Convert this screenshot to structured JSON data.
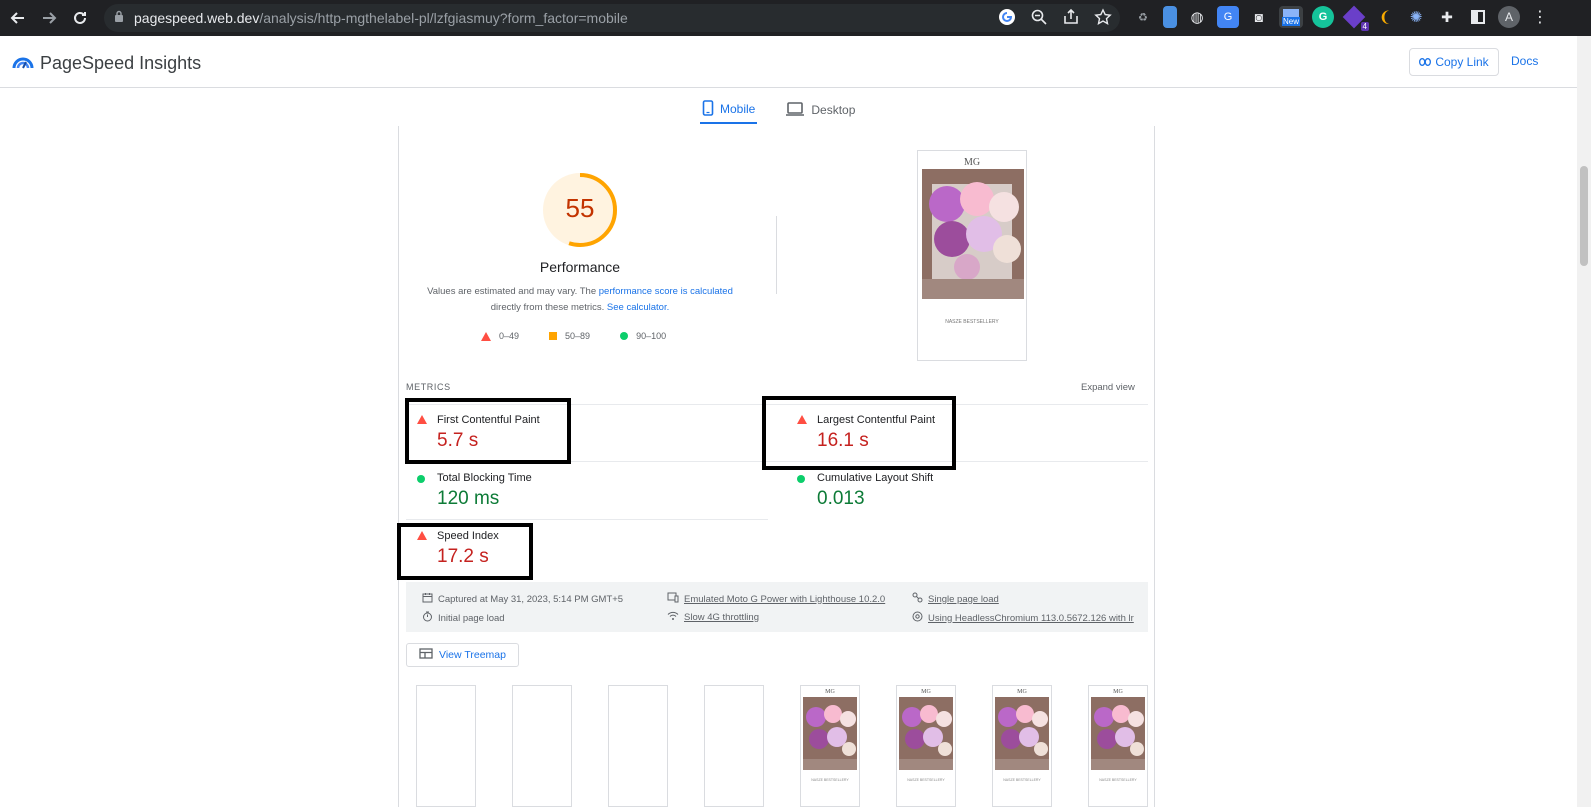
{
  "browser": {
    "url_host": "pagespeed.web.dev",
    "url_path": "/analysis/http-mgthelabel-pl/lzfgiasmuy?form_factor=mobile",
    "ext_badge_new": "New",
    "ext_badge_count": "4",
    "profile_initial": "A"
  },
  "header": {
    "title": "PageSpeed Insights",
    "copy_link": "Copy Link",
    "docs": "Docs"
  },
  "tabs": [
    {
      "label": "Mobile",
      "active": true
    },
    {
      "label": "Desktop",
      "active": false
    }
  ],
  "performance": {
    "score": "55",
    "label": "Performance",
    "note_prefix": "Values are estimated and may vary. The ",
    "note_link1": "performance score is calculated",
    "note_mid": " directly from these metrics. ",
    "note_link2": "See calculator.",
    "legend": [
      {
        "range": "0–49",
        "color": "#ff4e42"
      },
      {
        "range": "50–89",
        "color": "#ffa400"
      },
      {
        "range": "90–100",
        "color": "#0cce6b"
      }
    ]
  },
  "screenshot": {
    "logo": "MG",
    "caption": "NASZE BESTSELLERY"
  },
  "metrics": {
    "heading": "METRICS",
    "expand": "Expand view",
    "fcp": {
      "label": "First Contentful Paint",
      "value": "5.7 s"
    },
    "lcp": {
      "label": "Largest Contentful Paint",
      "value": "16.1 s"
    },
    "tbt": {
      "label": "Total Blocking Time",
      "value": "120 ms"
    },
    "cls": {
      "label": "Cumulative Layout Shift",
      "value": "0.013"
    },
    "si": {
      "label": "Speed Index",
      "value": "17.2 s"
    }
  },
  "environment": {
    "captured": "Captured at May 31, 2023, 5:14 PM GMT+5",
    "initial": "Initial page load",
    "device": "Emulated Moto G Power with Lighthouse 10.2.0",
    "throttling": "Slow 4G throttling",
    "single": "Single page load",
    "browser": "Using HeadlessChromium 113.0.5672.126 with lr"
  },
  "treemap": "View Treemap",
  "filmstrip": {
    "logo": "MG",
    "caption": "NASZE BESTSELLERY"
  },
  "colors": {
    "accent": "#1a73e8",
    "score_average": "#ffa400",
    "fail": "#ff4e42",
    "pass": "#0cce6b"
  }
}
